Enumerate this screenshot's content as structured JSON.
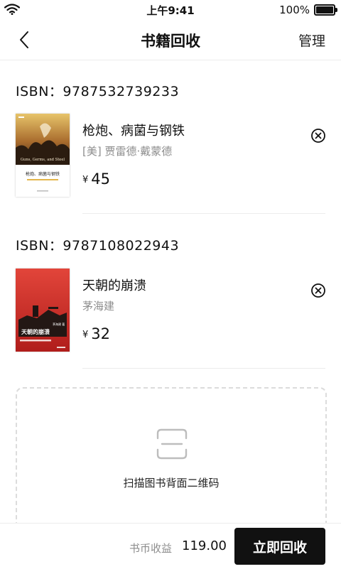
{
  "status_bar": {
    "time": "上午9:41",
    "battery_text": "100%",
    "icons": [
      "wifi-icon",
      "battery-icon"
    ]
  },
  "nav": {
    "title": "书籍回收",
    "manage_label": "管理",
    "back_icon": "chevron-left-icon"
  },
  "books": [
    {
      "isbn_label": "ISBN：9787532739233",
      "title": "枪炮、病菌与钢铁",
      "author": "[美] 贾雷德·戴蒙德",
      "currency": "¥",
      "price": "45",
      "cover_text": "Guns, Germs, and Steel",
      "cover_subtitle": "枪炮、病菌与钢铁"
    },
    {
      "isbn_label": "ISBN：9787108022943",
      "title": "天朝的崩溃",
      "author": "茅海建",
      "currency": "¥",
      "price": "32",
      "cover_text": "天朝的崩溃",
      "cover_author": "茅海建 著"
    }
  ],
  "scan": {
    "label": "扫描图书背面二维码",
    "icon": "scan-frame-icon"
  },
  "footer": {
    "earnings_label": "书币收益",
    "earnings_value": "119.00",
    "submit_label": "立即回收"
  },
  "colors": {
    "primary": "#111111",
    "muted": "#8d8d8d",
    "divider": "#ececec",
    "dashed_border": "#dcdcdc"
  }
}
